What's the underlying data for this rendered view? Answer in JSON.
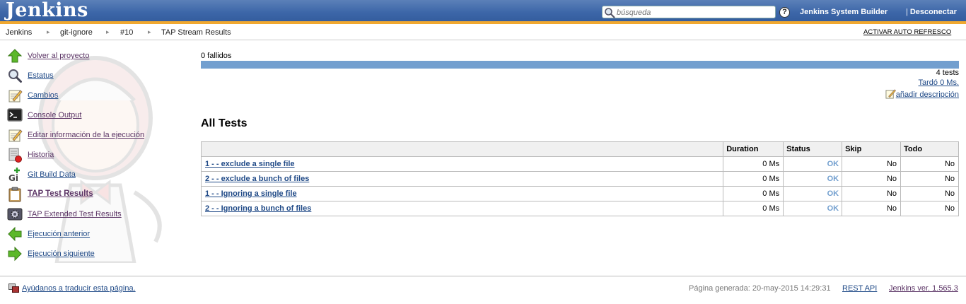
{
  "header": {
    "logo": "Jenkins",
    "search": {
      "placeholder": "búsqueda",
      "value": ""
    },
    "help": "?",
    "user": "Jenkins System Builder",
    "logout_sep": "|",
    "logout": "Desconectar",
    "accent": "#f0a830",
    "background": "#3c66a8"
  },
  "breadcrumb": {
    "items": [
      "Jenkins",
      "git-ignore",
      "#10",
      "TAP Stream Results"
    ],
    "separator": "▸",
    "auto_refresh": "ACTIVAR AUTO REFRESCO"
  },
  "sidebar": {
    "items": [
      {
        "label": "Volver al proyecto",
        "icon": "up-arrow-icon"
      },
      {
        "label": "Estatus",
        "icon": "magnifier-icon"
      },
      {
        "label": "Cambios",
        "icon": "notepad-icon"
      },
      {
        "label": "Console Output",
        "icon": "terminal-icon"
      },
      {
        "label": "Editar información de la ejecución",
        "icon": "notepad-icon"
      },
      {
        "label": "Historia",
        "icon": "history-icon"
      },
      {
        "label": "Git Build Data",
        "icon": "git-icon"
      },
      {
        "label": "TAP Test Results",
        "icon": "clipboard-icon"
      },
      {
        "label": "TAP Extended Test Results",
        "icon": "gear-icon"
      },
      {
        "label": "Ejecución anterior",
        "icon": "left-arrow-icon"
      },
      {
        "label": "Ejecución siguiente",
        "icon": "right-arrow-icon"
      }
    ]
  },
  "main": {
    "failed": "0 fallidos",
    "tests": "4 tests",
    "took": "Tardó 0 Ms.",
    "add_description": "añadir descripción",
    "section_title": "All Tests",
    "bar_color": "#729fcf",
    "table": {
      "headers": [
        "",
        "Duration",
        "Status",
        "Skip",
        "Todo"
      ],
      "rows": [
        {
          "name": "1 - - exclude a single file",
          "duration": "0 Ms",
          "status": "OK",
          "skip": "No",
          "todo": "No"
        },
        {
          "name": "2 - - exclude a bunch of files",
          "duration": "0 Ms",
          "status": "OK",
          "skip": "No",
          "todo": "No"
        },
        {
          "name": "1 - - Ignoring a single file",
          "duration": "0 Ms",
          "status": "OK",
          "skip": "No",
          "todo": "No"
        },
        {
          "name": "2 - - Ignoring a bunch of files",
          "duration": "0 Ms",
          "status": "OK",
          "skip": "No",
          "todo": "No"
        }
      ]
    }
  },
  "footer": {
    "translate": "Ayúdanos a traducir esta página.",
    "generated": "Página generada: 20-may-2015 14:29:31",
    "rest_api": "REST API",
    "version": "Jenkins ver. 1.565.3"
  }
}
